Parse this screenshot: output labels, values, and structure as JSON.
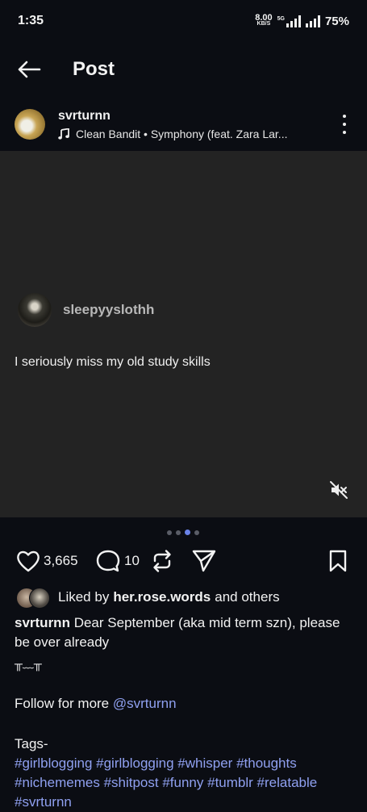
{
  "status_bar": {
    "time": "1:35",
    "net_speed": "8.00",
    "net_unit": "KB/S",
    "network_type": "5G",
    "battery": "75%"
  },
  "header": {
    "title": "Post",
    "back_icon": "arrow-left-icon"
  },
  "post": {
    "author": "svrturnn",
    "music": "Clean Bandit • Symphony (feat. Zara Lar...",
    "music_icon": "music-note-icon",
    "more_icon": "more-vertical-icon"
  },
  "media": {
    "embedded_user": "sleepyyslothh",
    "embedded_text": "I seriously miss my old study skills",
    "mute_icon": "volume-off-icon",
    "dots": {
      "count": 4,
      "active_index": 2
    }
  },
  "actions": {
    "likes": "3,665",
    "comments": "10",
    "icons": [
      "heart-icon",
      "comment-icon",
      "repost-icon",
      "share-icon",
      "bookmark-icon"
    ]
  },
  "liked_by": {
    "prefix": "Liked by",
    "user": "her.rose.words",
    "suffix": "and others"
  },
  "caption": {
    "author": "svrturnn",
    "text": "Dear September (aka mid term szn), please be over already",
    "kaomoji": "╥﹏╥",
    "follow_prefix": "Follow for more",
    "follow_link": "@svrturnn",
    "tags_label": "Tags-",
    "tags": [
      "#girlblogging",
      "#girlblogging",
      "#whisper",
      "#thoughts",
      "#nichememes",
      "#shitpost",
      "#funny",
      "#tumblr",
      "#relatable",
      "#svrturnn"
    ]
  },
  "colors": {
    "background": "#0b0d13",
    "media_background": "#232323",
    "link": "#8fa0f0",
    "active_dot": "#6a83e8"
  }
}
